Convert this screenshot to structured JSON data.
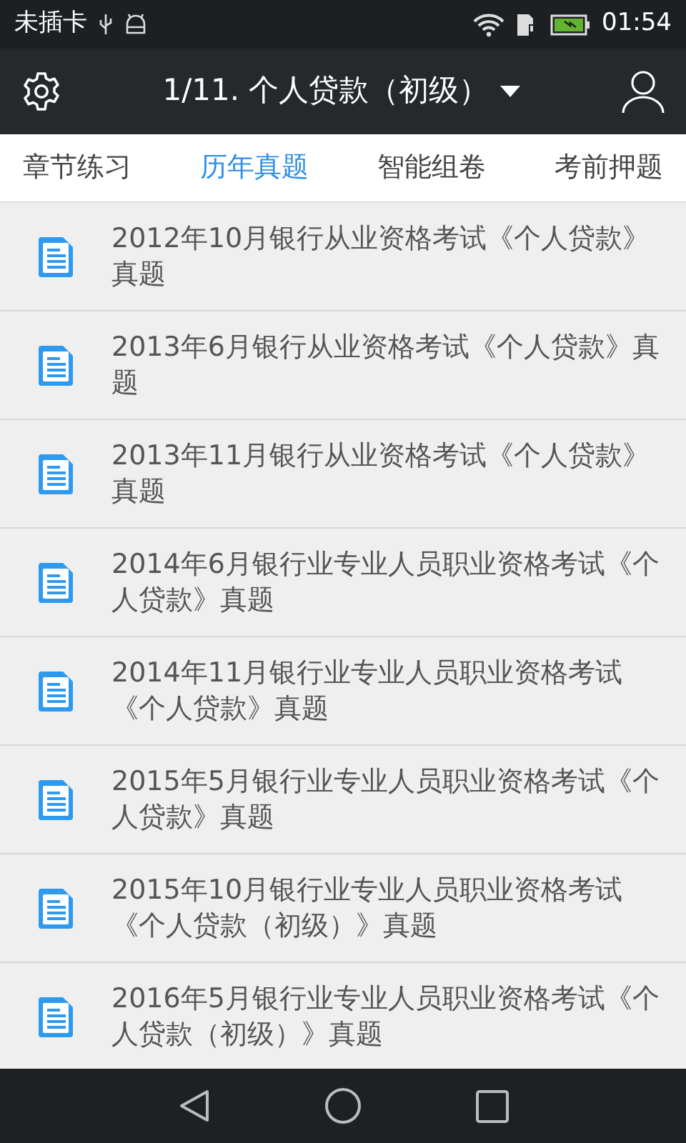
{
  "status_bar": {
    "carrier": "未插卡",
    "battery_charging": true,
    "time": "01:54"
  },
  "header": {
    "title": "1/11. 个人贷款（初级）"
  },
  "tabs": [
    {
      "label": "章节练习",
      "selected": false
    },
    {
      "label": "历年真题",
      "selected": true
    },
    {
      "label": "智能组卷",
      "selected": false
    },
    {
      "label": "考前押题",
      "selected": false
    }
  ],
  "papers": [
    {
      "title": "2012年10月银行从业资格考试《个人贷款》真题"
    },
    {
      "title": "2013年6月银行从业资格考试《个人贷款》真题"
    },
    {
      "title": "2013年11月银行从业资格考试《个人贷款》真题"
    },
    {
      "title": "2014年6月银行业专业人员职业资格考试《个人贷款》真题"
    },
    {
      "title": "2014年11月银行业专业人员职业资格考试《个人贷款》真题"
    },
    {
      "title": "2015年5月银行业专业人员职业资格考试《个人贷款》真题"
    },
    {
      "title": "2015年10月银行业专业人员职业资格考试《个人贷款（初级）》真题"
    },
    {
      "title": "2016年5月银行业专业人员职业资格考试《个人贷款（初级）》真题"
    }
  ]
}
